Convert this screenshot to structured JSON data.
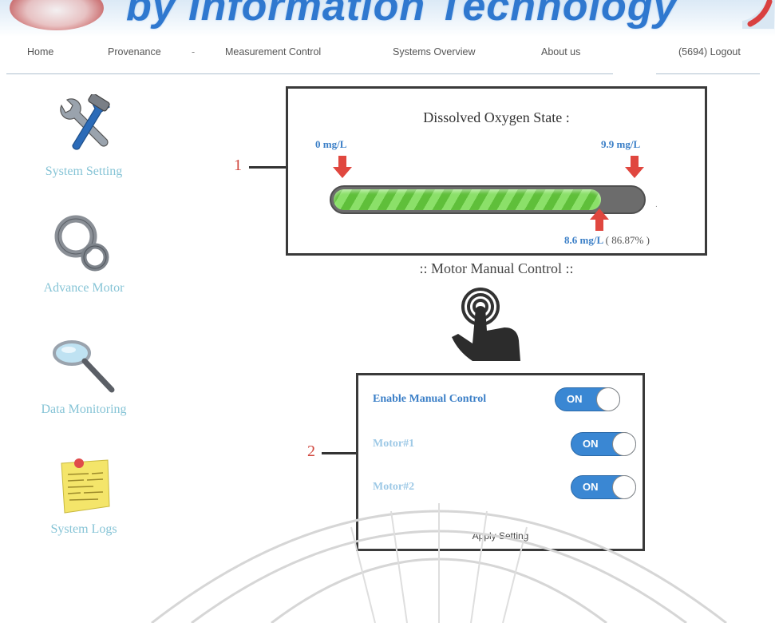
{
  "header": {
    "title": "by Information Technology"
  },
  "nav": {
    "items": [
      "Home",
      "Provenance",
      "Measurement Control",
      "Systems Overview",
      "About us"
    ],
    "logout": "(5694) Logout"
  },
  "sidebar": {
    "items": [
      {
        "label": "System Setting",
        "icon": "tools-icon"
      },
      {
        "label": "Advance Motor",
        "icon": "gears-icon"
      },
      {
        "label": "Data Monitoring",
        "icon": "magnifier-icon"
      },
      {
        "label": "System Logs",
        "icon": "sticky-note-icon"
      }
    ]
  },
  "dissolved_oxygen": {
    "title": "Dissolved Oxygen State :",
    "min_label": "0 mg/L",
    "max_label": "9.9 mg/L",
    "current_label": "8.6 mg/L",
    "percent_label": "( 86.87% )",
    "fraction": 0.8687,
    "callout": "1"
  },
  "motor": {
    "title": ":: Motor Manual Control ::",
    "callout": "2",
    "controls": [
      {
        "label": "Enable Manual Control",
        "state": "ON"
      },
      {
        "label": "Motor#1",
        "state": "ON"
      },
      {
        "label": "Motor#2",
        "state": "ON"
      }
    ],
    "apply_label": "Apply Setting"
  },
  "colors": {
    "accent": "#3a87d3",
    "label_blue": "#3b7fc7",
    "bar_green": "#5fbf3a",
    "arrow_red": "#e0473f",
    "sidebar_text": "#86c4d6"
  }
}
